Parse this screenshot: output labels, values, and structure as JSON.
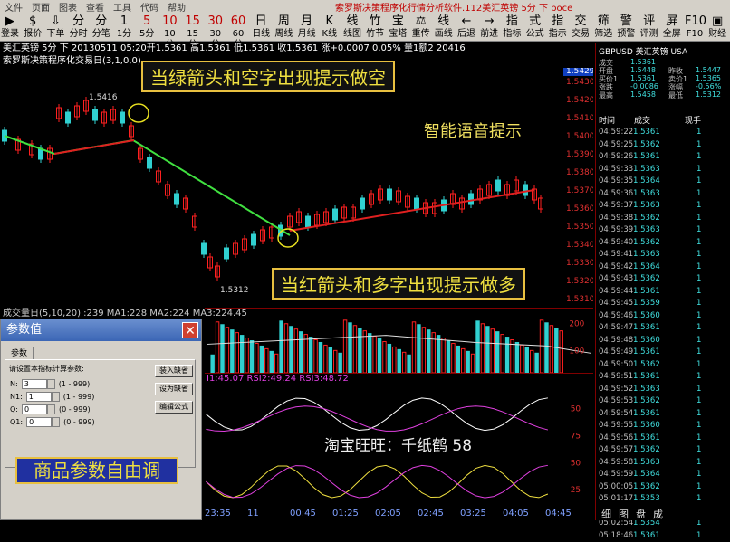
{
  "menubar": {
    "items": [
      "文件",
      "页面",
      "图表",
      "查看",
      "工具",
      "代码",
      "帮助"
    ],
    "title": "索罗斯决策程序化行情分析软件.112美汇英镑 5分 下 boce"
  },
  "toolbar": [
    {
      "g": "▶",
      "l": "登录"
    },
    {
      "g": "$",
      "l": "报价"
    },
    {
      "g": "⇩",
      "l": "下单"
    },
    {
      "g": "分",
      "l": "分时"
    },
    {
      "g": "分",
      "l": "分笔"
    },
    {
      "g": "1",
      "l": "1分"
    },
    {
      "g": "5",
      "l": "5分"
    },
    {
      "g": "10",
      "l": "10分"
    },
    {
      "g": "15",
      "l": "15分"
    },
    {
      "g": "30",
      "l": "30分"
    },
    {
      "g": "60",
      "l": "60分"
    },
    {
      "g": "日",
      "l": "日线"
    },
    {
      "g": "周",
      "l": "周线"
    },
    {
      "g": "月",
      "l": "月线"
    },
    {
      "g": "K",
      "l": "K线"
    },
    {
      "g": "线",
      "l": "线图"
    },
    {
      "g": "竹",
      "l": "竹节"
    },
    {
      "g": "宝",
      "l": "宝塔"
    },
    {
      "g": "⚖",
      "l": "重传"
    },
    {
      "g": "线",
      "l": "画线"
    },
    {
      "g": "←",
      "l": "后退"
    },
    {
      "g": "→",
      "l": "前进"
    },
    {
      "g": "指",
      "l": "指标"
    },
    {
      "g": "式",
      "l": "公式"
    },
    {
      "g": "指",
      "l": "指示"
    },
    {
      "g": "交",
      "l": "交易"
    },
    {
      "g": "筛",
      "l": "筛选"
    },
    {
      "g": "警",
      "l": "预警"
    },
    {
      "g": "评",
      "l": "评测"
    },
    {
      "g": "屏",
      "l": "全屏"
    },
    {
      "g": "F10",
      "l": "F10"
    },
    {
      "g": "▣",
      "l": "财经"
    }
  ],
  "infobar": "美汇英镑 5分 下 20130511 05:20开1.5361 高1.5361 低1.5361 收1.5361 涨+0.0007 0.05% 量1额2 20416",
  "subbar": "索罗斯决策程序化交易日(3,1,0,0)",
  "chart": {
    "price_labels": [
      "1.5430",
      "1.5420",
      "1.5410",
      "1.5400",
      "1.5390",
      "1.5380",
      "1.5370",
      "1.5360",
      "1.5350",
      "1.5340",
      "1.5330",
      "1.5320",
      "1.5310"
    ],
    "current_price": "1.5429",
    "high_label": "1.5416",
    "low_label": "1.5312"
  },
  "callouts": {
    "short": "当绿箭头和空字出现提示做空",
    "long": "当红箭头和多字出现提示做多",
    "voice": "智能语音提示",
    "taobao": "淘宝旺旺：千纸鹤 58",
    "params": "商品参数自由调"
  },
  "vol_head": "成交量日(5,10,20) :239 MA1:228 MA2:224 MA3:224.45",
  "vol_ticks": [
    "200",
    "100"
  ],
  "rsi_head": "I1:45.07 RSI2:49.24 RSI3:48.72",
  "rsi_ticks": [
    "50",
    "75",
    "50",
    "25"
  ],
  "xaxis": [
    "23:35",
    "11",
    "00:45",
    "01:25",
    "02:05",
    "02:45",
    "03:25",
    "04:05",
    "04:45"
  ],
  "right": {
    "header": "GBPUSD 美汇英镑 USA",
    "quotes": [
      [
        "成交",
        "1.5361",
        "",
        ""
      ],
      [
        "开盘",
        "1.5448",
        "昨收",
        "1.5447"
      ],
      [
        "买价1",
        "1.5361",
        "卖价1",
        "1.5365"
      ],
      [
        "涨跌",
        "-0.0086",
        "涨幅",
        "-0.56%"
      ],
      [
        "最高",
        "1.5458",
        "最低",
        "1.5312"
      ]
    ],
    "trade_head": [
      "时间",
      "成交",
      "现手"
    ],
    "trades": [
      [
        "04:59:22",
        "1.5361",
        "1"
      ],
      [
        "04:59:25",
        "1.5362",
        "1"
      ],
      [
        "04:59:26",
        "1.5361",
        "1"
      ],
      [
        "04:59:33",
        "1.5363",
        "1"
      ],
      [
        "04:59:35",
        "1.5364",
        "1"
      ],
      [
        "04:59:36",
        "1.5363",
        "1"
      ],
      [
        "04:59:37",
        "1.5363",
        "1"
      ],
      [
        "04:59:38",
        "1.5362",
        "1"
      ],
      [
        "04:59:39",
        "1.5363",
        "1"
      ],
      [
        "04:59:40",
        "1.5362",
        "1"
      ],
      [
        "04:59:41",
        "1.5363",
        "1"
      ],
      [
        "04:59:42",
        "1.5364",
        "1"
      ],
      [
        "04:59:43",
        "1.5362",
        "1"
      ],
      [
        "04:59:44",
        "1.5361",
        "1"
      ],
      [
        "04:59:45",
        "1.5359",
        "1"
      ],
      [
        "04:59:46",
        "1.5360",
        "1"
      ],
      [
        "04:59:47",
        "1.5361",
        "1"
      ],
      [
        "04:59:48",
        "1.5360",
        "1"
      ],
      [
        "04:59:49",
        "1.5361",
        "1"
      ],
      [
        "04:59:50",
        "1.5362",
        "1"
      ],
      [
        "04:59:51",
        "1.5361",
        "1"
      ],
      [
        "04:59:52",
        "1.5363",
        "1"
      ],
      [
        "04:59:53",
        "1.5362",
        "1"
      ],
      [
        "04:59:54",
        "1.5361",
        "1"
      ],
      [
        "04:59:55",
        "1.5360",
        "1"
      ],
      [
        "04:59:56",
        "1.5361",
        "1"
      ],
      [
        "04:59:57",
        "1.5362",
        "1"
      ],
      [
        "04:59:58",
        "1.5363",
        "1"
      ],
      [
        "04:59:59",
        "1.5364",
        "1"
      ],
      [
        "05:00:05",
        "1.5362",
        "1"
      ],
      [
        "05:01:17",
        "1.5353",
        "1"
      ],
      [
        "05:01:27",
        "1.5352",
        "1"
      ],
      [
        "05:02:54",
        "1.5354",
        "1"
      ],
      [
        "05:18:46",
        "1.5361",
        "1"
      ]
    ]
  },
  "bottomtabs": [
    "细",
    "图",
    "盘",
    "成"
  ],
  "dialog": {
    "title": "参数值",
    "tab": "参数",
    "desc": "请设置本指标计算参数:",
    "params": [
      [
        "N:",
        "3",
        "(1 - 999)"
      ],
      [
        "N1:",
        "1",
        "(1 - 999)"
      ],
      [
        "Q:",
        "0",
        "(0 - 999)"
      ],
      [
        "Q1:",
        "0",
        "(0 - 999)"
      ]
    ],
    "buttons": [
      "装入缺省",
      "设为缺省",
      "编辑公式"
    ]
  }
}
